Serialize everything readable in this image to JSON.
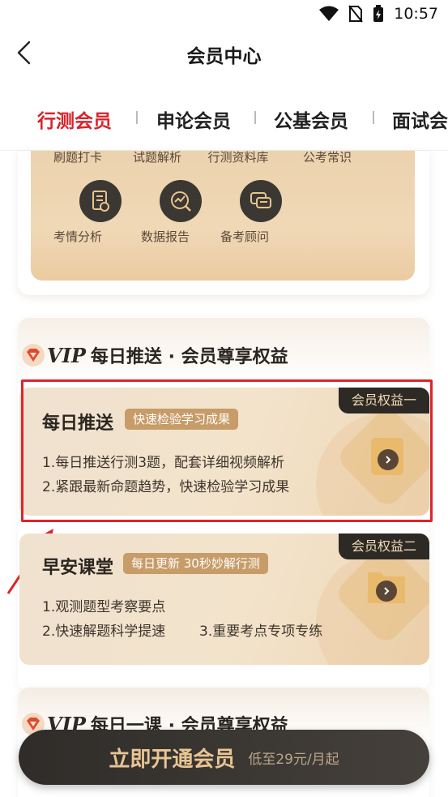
{
  "status": {
    "time": "10:57"
  },
  "nav": {
    "title": "会员中心"
  },
  "tabs": [
    {
      "label": "行测会员",
      "active": true
    },
    {
      "label": "申论会员"
    },
    {
      "label": "公基会员"
    },
    {
      "label": "面试会"
    }
  ],
  "features": {
    "row1": [
      "刷题打卡",
      "试题解析",
      "行测资料库",
      "公考常识"
    ],
    "row2": [
      "考情分析",
      "数据报告",
      "备考顾问"
    ]
  },
  "vip": {
    "badge": "VIP",
    "title": "每日推送 · 会员尊享权益"
  },
  "benefits": [
    {
      "tag": "会员权益一",
      "title": "每日推送",
      "pill": "快速检验学习成果",
      "lines": [
        "1.每日推送行测3题，配套详细视频解析",
        "2.紧跟最新命题趋势，快速检验学习成果"
      ]
    },
    {
      "tag": "会员权益二",
      "title": "早安课堂",
      "pill": "每日更新 30秒妙解行测",
      "lines": [
        "1.观测题型考察要点",
        "2.快速解题科学提速",
        "3.重要考点专项专练"
      ]
    }
  ],
  "vip2": {
    "badge": "VIP",
    "title": "每日一课 · 会员尊享权益"
  },
  "cta": {
    "main": "立即开通会员",
    "sub": "低至29元/月起"
  },
  "colors": {
    "accent": "#d8232a",
    "gold": "#e9c594",
    "dark": "#2d2925"
  }
}
